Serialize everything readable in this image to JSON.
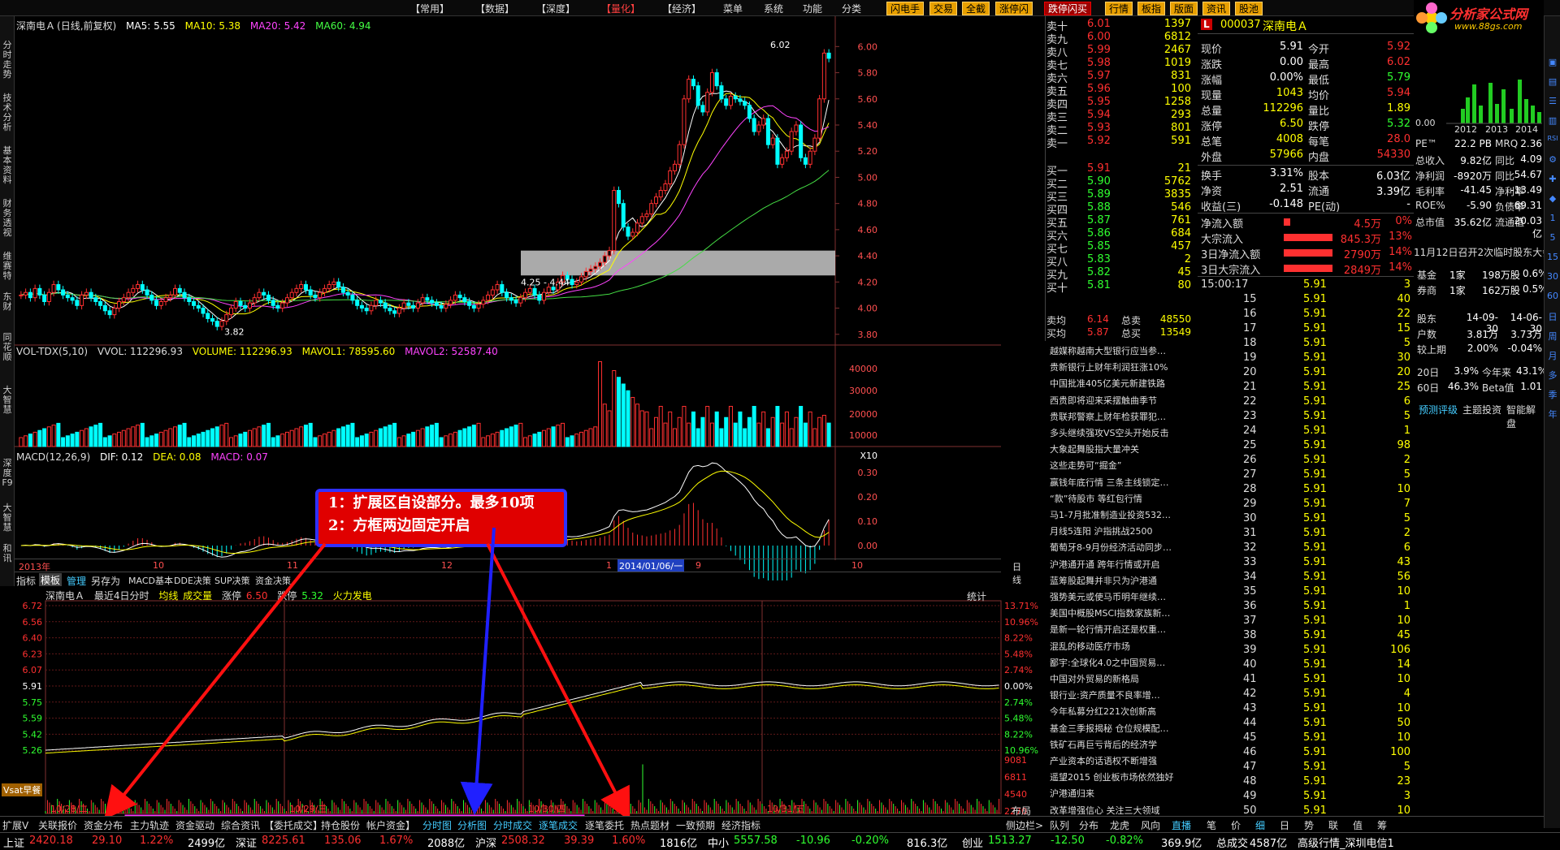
{
  "top_menu": [
    "【常用】",
    "【数据】",
    "【深度】",
    "【量化】",
    "【经济】",
    "菜单",
    "系统",
    "功能",
    "分类"
  ],
  "top_buttons": [
    "闪电手",
    "交易",
    "全截",
    "涨停闪",
    "跌停闪买",
    "行情",
    "板指",
    "版面",
    "资讯",
    "股池"
  ],
  "left_tabs": [
    "分时走势",
    "技术分析",
    "基本资料",
    "财务透视",
    "维赛特",
    "东财",
    "同花顺",
    "大智慧",
    "深度F9",
    "大智慧",
    "和讯"
  ],
  "kline": {
    "stock": "深南电Ａ",
    "period": "(日线,前复权)",
    "ma5": "MA5: 5.55",
    "ma10": "MA10: 5.38",
    "ma20": "MA20: 5.42",
    "ma60": "MA60: 4.94",
    "high_label": "6.02",
    "low_label": "3.82",
    "mid_label": "4.25 - 4.44",
    "yticks": [
      "6.00",
      "5.80",
      "5.60",
      "5.40",
      "5.20",
      "5.00",
      "4.80",
      "4.60",
      "4.40",
      "4.20",
      "4.00",
      "3.80"
    ],
    "closes": [
      4.1,
      4.12,
      4.08,
      4.15,
      4.1,
      4.05,
      4.12,
      4.18,
      4.14,
      4.1,
      4.08,
      4.06,
      4.02,
      4.1,
      4.12,
      4.08,
      4.05,
      4.02,
      3.98,
      3.95,
      4.0,
      4.05,
      4.08,
      4.12,
      4.15,
      4.18,
      4.14,
      4.1,
      4.06,
      4.02,
      4.05,
      4.08,
      4.1,
      4.15,
      4.12,
      4.08,
      4.05,
      4.02,
      4.0,
      3.96,
      3.92,
      3.9,
      3.86,
      3.9,
      3.95,
      4.0,
      4.05,
      4.02,
      4.0,
      4.04,
      4.08,
      4.12,
      4.1,
      4.06,
      4.02,
      4.0,
      4.04,
      4.08,
      4.12,
      4.15,
      4.18,
      4.14,
      4.1,
      4.08,
      4.12,
      4.15,
      4.18,
      4.2,
      4.16,
      4.12,
      4.1,
      4.06,
      4.02,
      4.0,
      3.98,
      4.02,
      4.06,
      4.04,
      4.0,
      3.98,
      3.96,
      4.0,
      4.04,
      4.02,
      4.0,
      4.04,
      4.08,
      4.06,
      4.04,
      4.02,
      4.0,
      4.03,
      4.06,
      4.1,
      4.08,
      4.05,
      4.02,
      4.0,
      4.03,
      4.06,
      4.1,
      4.14,
      4.18,
      4.12,
      4.08,
      4.06,
      4.04,
      4.08,
      4.12,
      4.15,
      4.1,
      4.06,
      4.12,
      4.16,
      4.14,
      4.2,
      4.25,
      4.22,
      4.18,
      4.2,
      4.24,
      4.28,
      4.3,
      4.32,
      4.35,
      4.4,
      4.44,
      4.9,
      4.8,
      4.62,
      4.55,
      4.58,
      4.65,
      4.7,
      4.72,
      4.8,
      4.85,
      4.9,
      4.95,
      5.05,
      5.1,
      5.25,
      5.6,
      5.75,
      5.7,
      5.55,
      5.5,
      5.65,
      5.8,
      5.7,
      5.6,
      5.55,
      5.62,
      5.6,
      5.58,
      5.55,
      5.45,
      5.35,
      5.4,
      5.45,
      5.25,
      5.3,
      5.1,
      5.15,
      5.2,
      5.35,
      5.4,
      5.15,
      5.1,
      5.2,
      5.3,
      5.6,
      5.95,
      5.91
    ]
  },
  "vol": {
    "hdr": [
      "VOL-TDX(5,10)",
      "VVOL: 112296.93",
      "VOLUME: 112296.93",
      "MAVOL1: 78595.60",
      "MAVOL2: 52587.40"
    ],
    "yticks": [
      "40000",
      "30000",
      "20000",
      "10000",
      "X10"
    ]
  },
  "macd": {
    "hdr": [
      "MACD(12,26,9)",
      "DIF: 0.12",
      "DEA: 0.08",
      "MACD: 0.07"
    ],
    "yticks": [
      "0.30",
      "0.20",
      "0.10",
      "0.00"
    ]
  },
  "date_axis": [
    "2013年",
    "10",
    "11",
    "12",
    "1",
    "2014/01/06/一",
    "9",
    "10"
  ],
  "date_right": "日线",
  "tabs": [
    "指标",
    "模板",
    "管理",
    "另存为",
    "MACD基本",
    "DDE决策",
    "SUP决策",
    "资金决策"
  ],
  "intraday": {
    "hdr": [
      "深南电Ａ",
      "最近4日分时",
      "均线",
      "成交量",
      "涨停",
      "6.50",
      "跌停",
      "5.32",
      "火力发电"
    ],
    "right": "统计",
    "yticks": [
      "6.72",
      "6.56",
      "6.40",
      "6.23",
      "6.07",
      "5.91",
      "5.75",
      "5.59",
      "5.42",
      "5.26"
    ],
    "pct": [
      "13.71%",
      "10.96%",
      "8.22%",
      "5.48%",
      "2.74%",
      "0.00%",
      "2.74%",
      "5.48%",
      "8.22%",
      "10.96%"
    ],
    "voltick": [
      "9081",
      "6811",
      "4540",
      "2270"
    ],
    "dates": [
      "10/28/二",
      "10/29/三",
      "10/30/四",
      "10/31/五"
    ],
    "bottom_right": "布局",
    "vsat": "Vsat早餐"
  },
  "callout": [
    "1：扩展区自设部分。最多10项",
    "2：方框两边固定开启"
  ],
  "bottom_tabs": [
    "扩展V",
    "关联报价",
    "资金分布",
    "主力轨迹",
    "资金驱动",
    "综合资讯",
    "【委托成交】",
    "持仓股份",
    "帐户资金】",
    "分时图",
    "分析图",
    "分时成交",
    "逐笔成交",
    "逐笔委托",
    "热点题材",
    "一致预期",
    "经济指标"
  ],
  "bottom_right_tabs": [
    "侧边栏>",
    "队列",
    "分布",
    "龙虎",
    "风向",
    "直播",
    "笔",
    "价",
    "细",
    "日",
    "势",
    "联",
    "值",
    "筹"
  ],
  "status": [
    {
      "t": "上证",
      "c": "#fff"
    },
    {
      "t": "2420.18",
      "c": "#ff3030"
    },
    {
      "t": "29.10",
      "c": "#ff3030"
    },
    {
      "t": "1.22%",
      "c": "#ff3030"
    },
    {
      "t": "2499亿",
      "c": "#fff"
    },
    {
      "t": "深证",
      "c": "#fff"
    },
    {
      "t": "8225.61",
      "c": "#ff3030"
    },
    {
      "t": "135.06",
      "c": "#ff3030"
    },
    {
      "t": "1.67%",
      "c": "#ff3030"
    },
    {
      "t": "2088亿",
      "c": "#fff"
    },
    {
      "t": "沪深",
      "c": "#fff"
    },
    {
      "t": "2508.32",
      "c": "#ff3030"
    },
    {
      "t": "39.39",
      "c": "#ff3030"
    },
    {
      "t": "1.60%",
      "c": "#ff3030"
    },
    {
      "t": "1816亿",
      "c": "#fff"
    },
    {
      "t": "中小",
      "c": "#fff"
    },
    {
      "t": "5557.58",
      "c": "#30ff30"
    },
    {
      "t": "-10.96",
      "c": "#30ff30"
    },
    {
      "t": "-0.20%",
      "c": "#30ff30"
    },
    {
      "t": "816.3亿",
      "c": "#fff"
    },
    {
      "t": "创业",
      "c": "#fff"
    },
    {
      "t": "1513.27",
      "c": "#30ff30"
    },
    {
      "t": "-12.50",
      "c": "#30ff30"
    },
    {
      "t": "-0.82%",
      "c": "#30ff30"
    },
    {
      "t": "369.9亿",
      "c": "#fff"
    },
    {
      "t": "总成交",
      "c": "#fff"
    },
    {
      "t": "4587亿",
      "c": "#fff"
    },
    {
      "t": "高级行情_深圳电信1",
      "c": "#fff"
    }
  ],
  "orderbook": {
    "sells": [
      [
        "卖十",
        "6.01",
        "1397"
      ],
      [
        "卖九",
        "6.00",
        "6812"
      ],
      [
        "卖八",
        "5.99",
        "2467"
      ],
      [
        "卖七",
        "5.98",
        "1019"
      ],
      [
        "卖六",
        "5.97",
        "831"
      ],
      [
        "卖五",
        "5.96",
        "100"
      ],
      [
        "卖四",
        "5.95",
        "1258"
      ],
      [
        "卖三",
        "5.94",
        "293"
      ],
      [
        "卖二",
        "5.93",
        "801"
      ],
      [
        "卖一",
        "5.92",
        "591"
      ]
    ],
    "buys": [
      [
        "买一",
        "5.91",
        "21"
      ],
      [
        "买二",
        "5.90",
        "5762"
      ],
      [
        "买三",
        "5.89",
        "3835"
      ],
      [
        "买四",
        "5.88",
        "546"
      ],
      [
        "买五",
        "5.87",
        "761"
      ],
      [
        "买六",
        "5.86",
        "684"
      ],
      [
        "买七",
        "5.85",
        "457"
      ],
      [
        "买八",
        "5.83",
        "2"
      ],
      [
        "买九",
        "5.82",
        "45"
      ],
      [
        "买十",
        "5.81",
        "80"
      ]
    ],
    "avg": [
      [
        "卖均",
        "6.14",
        "总卖",
        "48550"
      ],
      [
        "买均",
        "5.87",
        "总买",
        "13549"
      ]
    ]
  },
  "news": [
    "越媒称越南大型银行应当参…",
    "贵新银行上财年利润狂涨10%",
    "中国批准405亿美元新建铁路",
    "西贵即将迎来采摆触曲季节",
    "贵联邦警察上财年检获罪犯…",
    "多头继续强攻VS空头开始反击",
    "大象起舞股指大量冲关",
    "这些走势可“掘金”",
    "赢钱年底行情 三条主线锁定…",
    "“款”待股市 等红包行情",
    "马1-7月批准制造业投资532…",
    "月线5连阳 沪指挑战2500",
    "葡萄牙8-9月份经济活动同步…",
    "沪港通开通 跨年行情或开启",
    "蓝筹股起舞并非只为沪港通",
    "强势美元或使马币明年继续…",
    "美国中概股MSCI指数家族新…",
    "是新一轮行情开启还是权重…",
    "混乱的移动医疗市场",
    "鄙宇:全球化4.0之中国贸易…",
    "中国对外贸易的新格局",
    "银行业:资产质量不良率增…",
    "今年私募分红221次创新高",
    "基金三季报揭秘 仓位规模配…",
    "铁矿石再巨亏背后的经济学",
    "产业资本的话语权不断增强",
    "遥望2015 创业板市场依然独好",
    "沪港通归来",
    "改革增强信心 关注三大领域"
  ],
  "quote": {
    "code": "000037",
    "name": "深南电Ａ",
    "rows": [
      [
        "现价",
        "5.91",
        "今开",
        "5.92"
      ],
      [
        "涨跌",
        "0.00",
        "最高",
        "6.02"
      ],
      [
        "涨幅",
        "0.00%",
        "最低",
        "5.79"
      ],
      [
        "现量",
        "1043",
        "均价",
        "5.94"
      ],
      [
        "总量",
        "112296",
        "量比",
        "1.89"
      ],
      [
        "涨停",
        "6.50",
        "跌停",
        "5.32"
      ],
      [
        "总笔",
        "4008",
        "每笔",
        "28.0"
      ],
      [
        "外盘",
        "57966",
        "内盘",
        "54330"
      ]
    ],
    "rows2": [
      [
        "换手",
        "3.31%",
        "股本",
        "6.03亿"
      ],
      [
        "净资",
        "2.51",
        "流通",
        "3.39亿"
      ],
      [
        "收益(三)",
        "-0.148",
        "PE(动)",
        "-"
      ]
    ],
    "flows": [
      [
        "净流入额",
        "4.5万",
        "0%"
      ],
      [
        "大宗流入",
        "845.3万",
        "13%"
      ],
      [
        "3日净流入额",
        "2790万",
        "14%"
      ],
      [
        "3日大宗流入",
        "2849万",
        "14%"
      ]
    ],
    "ticks_time": "15:00:17",
    "ticks": [
      [
        "15",
        "5.91",
        "40"
      ],
      [
        "16",
        "5.91",
        "22"
      ],
      [
        "17",
        "5.91",
        "15"
      ],
      [
        "18",
        "5.91",
        "5"
      ],
      [
        "19",
        "5.91",
        "30"
      ],
      [
        "20",
        "5.91",
        "20"
      ],
      [
        "21",
        "5.91",
        "25"
      ],
      [
        "22",
        "5.91",
        "6"
      ],
      [
        "23",
        "5.91",
        "5"
      ],
      [
        "24",
        "5.91",
        "1"
      ],
      [
        "25",
        "5.91",
        "98"
      ],
      [
        "26",
        "5.91",
        "2"
      ],
      [
        "27",
        "5.91",
        "5"
      ],
      [
        "28",
        "5.91",
        "10"
      ],
      [
        "29",
        "5.91",
        "7"
      ],
      [
        "30",
        "5.91",
        "5"
      ],
      [
        "31",
        "5.91",
        "2"
      ],
      [
        "32",
        "5.91",
        "6"
      ],
      [
        "33",
        "5.91",
        "43"
      ],
      [
        "34",
        "5.91",
        "56"
      ],
      [
        "35",
        "5.91",
        "10"
      ],
      [
        "36",
        "5.91",
        "1"
      ],
      [
        "37",
        "5.91",
        "10"
      ],
      [
        "38",
        "5.91",
        "45"
      ],
      [
        "39",
        "5.91",
        "106"
      ],
      [
        "40",
        "5.91",
        "14"
      ],
      [
        "41",
        "5.91",
        "10"
      ],
      [
        "42",
        "5.91",
        "4"
      ],
      [
        "43",
        "5.91",
        "10"
      ],
      [
        "44",
        "5.91",
        "50"
      ],
      [
        "45",
        "5.91",
        "10"
      ],
      [
        "46",
        "5.91",
        "100"
      ],
      [
        "47",
        "5.91",
        "5"
      ],
      [
        "48",
        "5.91",
        "23"
      ],
      [
        "49",
        "5.91",
        "3"
      ],
      [
        "50",
        "5.91",
        "10"
      ]
    ],
    "first_tick": [
      "5.91",
      "3"
    ]
  },
  "right": {
    "brand": "分析家公式网",
    "url": "www.88gs.com",
    "years": [
      "2012",
      "2013",
      "2014"
    ],
    "y0": "0.00",
    "fin": [
      [
        "PE™",
        "22.2 PB",
        "MRQ",
        "2.36"
      ],
      [
        "总收入",
        "9.82亿",
        "同比",
        "4.09"
      ],
      [
        "净利润",
        "-8920万",
        "同比",
        "54.67"
      ],
      [
        "毛利率",
        "-41.45",
        "净利率",
        "-13.49"
      ],
      [
        "ROE%",
        "-5.90",
        "负债率",
        "69.31"
      ],
      [
        "总市值",
        "35.62亿",
        "流通值",
        "20.03亿"
      ]
    ],
    "event": "11月12日召开2次临时股东大会",
    "holders": [
      [
        "基金",
        "1家",
        "198万股",
        "0.6%"
      ],
      [
        "券商",
        "1家",
        "162万股",
        "0.5%"
      ]
    ],
    "holders2": [
      [
        "股东",
        "14-09-30",
        "14-06-30"
      ],
      [
        "户数",
        "3.81万",
        "3.73万"
      ],
      [
        "较上期",
        "2.00%",
        "-0.04%"
      ]
    ],
    "perf": [
      [
        "20日",
        "3.9%",
        "今年来",
        "43.1%"
      ],
      [
        "60日",
        "46.3%",
        "Beta值",
        "1.01"
      ]
    ],
    "links": [
      "预测评级",
      "主题投资",
      "智能解盘"
    ]
  },
  "icons_right": [
    "window-icon",
    "grid-icon",
    "list-icon",
    "chart-icon",
    "rsi-icon",
    "settings-icon"
  ]
}
